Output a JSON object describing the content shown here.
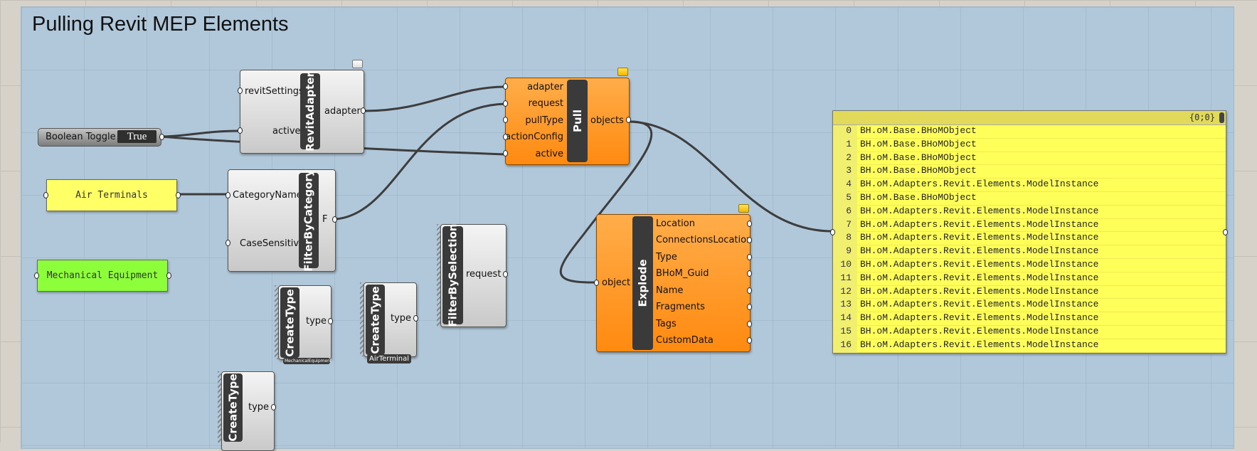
{
  "title": "Pulling Revit MEP Elements",
  "toggle": {
    "label": "Boolean Toggle",
    "value": "True"
  },
  "panels": {
    "air_terminals": "Air Terminals",
    "mech_equipment": "Mechanical Equipment"
  },
  "revit_adapter": {
    "name": "RevitAdapter",
    "inputs": [
      "revitSettings",
      "active"
    ],
    "outputs": [
      "adapter"
    ]
  },
  "pull": {
    "name": "Pull",
    "inputs": [
      "adapter",
      "request",
      "pullType",
      "actionConfig",
      "active"
    ],
    "outputs": [
      "objects"
    ]
  },
  "filter_by_category": {
    "name": "FilterByCategory",
    "inputs": [
      "CategoryName",
      "CaseSensitive"
    ],
    "outputs": [
      "F"
    ]
  },
  "filter_by_selection": {
    "name": "FilterBySelection",
    "outputs": [
      "request"
    ]
  },
  "create_type_1": {
    "name": "CreateType",
    "output": "type",
    "tag": "MechanicalEquipment"
  },
  "create_type_2": {
    "name": "CreateType",
    "output": "type",
    "tag": "AirTerminal"
  },
  "create_type_3": {
    "name": "CreateType",
    "output": "type"
  },
  "explode": {
    "name": "Explode",
    "inputs": [
      "object"
    ],
    "outputs": [
      "Location",
      "ConnectionsLocation",
      "Type",
      "BHoM_Guid",
      "Name",
      "Fragments",
      "Tags",
      "CustomData"
    ]
  },
  "viewer": {
    "path": "{0;0}",
    "items": [
      {
        "i": "0",
        "v": "BH.oM.Base.BHoMObject"
      },
      {
        "i": "1",
        "v": "BH.oM.Base.BHoMObject"
      },
      {
        "i": "2",
        "v": "BH.oM.Base.BHoMObject"
      },
      {
        "i": "3",
        "v": "BH.oM.Base.BHoMObject"
      },
      {
        "i": "4",
        "v": "BH.oM.Adapters.Revit.Elements.ModelInstance"
      },
      {
        "i": "5",
        "v": "BH.oM.Base.BHoMObject"
      },
      {
        "i": "6",
        "v": "BH.oM.Adapters.Revit.Elements.ModelInstance"
      },
      {
        "i": "7",
        "v": "BH.oM.Adapters.Revit.Elements.ModelInstance"
      },
      {
        "i": "8",
        "v": "BH.oM.Adapters.Revit.Elements.ModelInstance"
      },
      {
        "i": "9",
        "v": "BH.oM.Adapters.Revit.Elements.ModelInstance"
      },
      {
        "i": "10",
        "v": "BH.oM.Adapters.Revit.Elements.ModelInstance"
      },
      {
        "i": "11",
        "v": "BH.oM.Adapters.Revit.Elements.ModelInstance"
      },
      {
        "i": "12",
        "v": "BH.oM.Adapters.Revit.Elements.ModelInstance"
      },
      {
        "i": "13",
        "v": "BH.oM.Adapters.Revit.Elements.ModelInstance"
      },
      {
        "i": "14",
        "v": "BH.oM.Adapters.Revit.Elements.ModelInstance"
      },
      {
        "i": "15",
        "v": "BH.oM.Adapters.Revit.Elements.ModelInstance"
      },
      {
        "i": "16",
        "v": "BH.oM.Adapters.Revit.Elements.ModelInstance"
      }
    ]
  }
}
